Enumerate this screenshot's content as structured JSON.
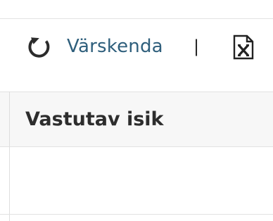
{
  "toolbar": {
    "refresh_label": "Värskenda",
    "separator": "|",
    "refresh_icon": "refresh-icon",
    "export_icon": "excel-export-icon"
  },
  "grid": {
    "columns": [
      "Vastutav isik"
    ],
    "rows": [
      [
        ""
      ]
    ]
  },
  "colors": {
    "link": "#2f5f7c",
    "header_background": "#f7f7f7",
    "border": "#e2e2e2"
  }
}
